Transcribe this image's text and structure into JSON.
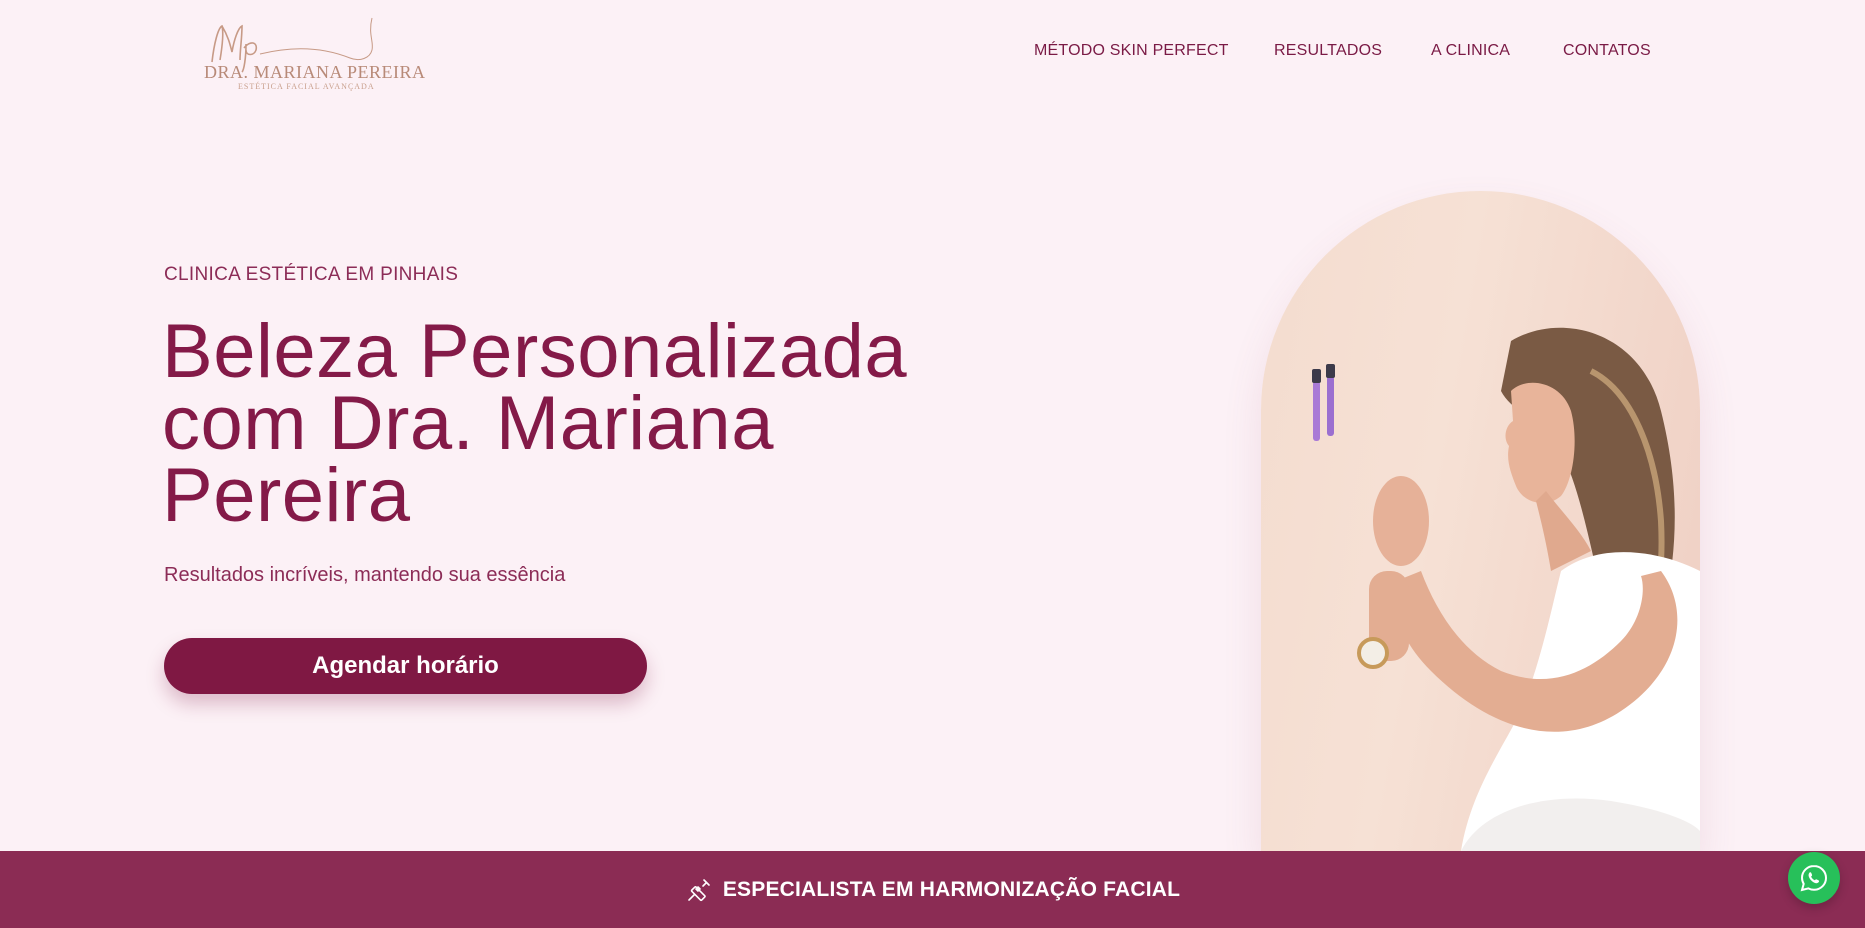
{
  "header": {
    "logo": {
      "monogram": "Mp",
      "name": "DRA. MARIANA PEREIRA",
      "tagline": "ESTÉTICA FACIAL AVANÇADA"
    },
    "nav": [
      {
        "label": "MÉTODO SKIN PERFECT"
      },
      {
        "label": "RESULTADOS"
      },
      {
        "label": "A CLINICA"
      },
      {
        "label": "CONTATOS"
      }
    ]
  },
  "hero": {
    "eyebrow": "CLINICA ESTÉTICA EM PINHAIS",
    "title_lines": [
      "Beleza Personalizada",
      "com Dra. Mariana",
      "Pereira"
    ],
    "subtitle": "Resultados incríveis, mantendo sua essência",
    "cta_label": "Agendar horário"
  },
  "banner": {
    "icon": "syringe-icon",
    "text": "ESPECIALISTA EM HARMONIZAÇÃO FACIAL"
  },
  "floating": {
    "icon": "whatsapp-icon"
  },
  "colors": {
    "background": "#fcf1f6",
    "primary": "#841a48",
    "banner": "#8b2c54",
    "whatsapp": "#27c05a"
  }
}
